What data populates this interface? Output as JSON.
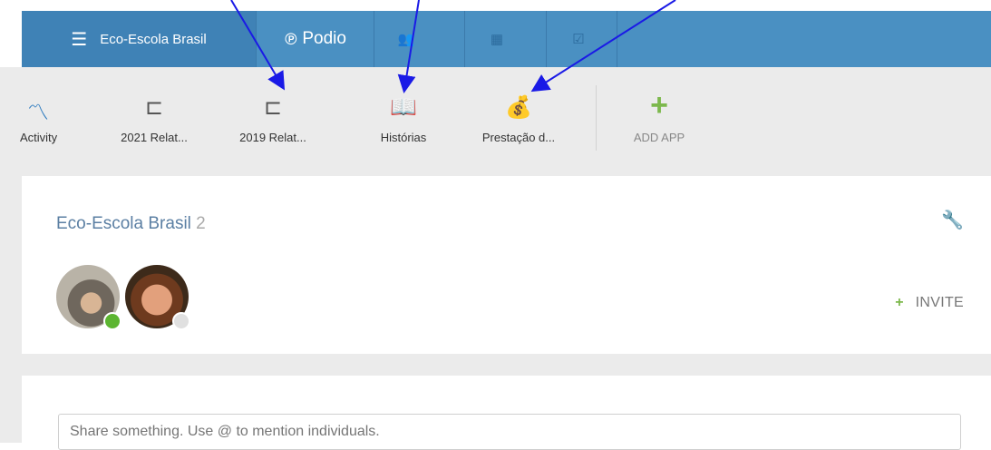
{
  "topbar": {
    "workspace_name": "Eco-Escola Brasil",
    "brand": "Podio",
    "icons": [
      "contacts-icon",
      "calendar-icon",
      "tasks-icon"
    ]
  },
  "apps": [
    {
      "label": "Activity",
      "icon": "activity-icon"
    },
    {
      "label": "2021 Relat...",
      "icon": "inbox-icon"
    },
    {
      "label": "2019 Relat...",
      "icon": "inbox-icon"
    },
    {
      "label": "Histórias",
      "icon": "book-icon"
    },
    {
      "label": "Prestação d...",
      "icon": "money-bag-icon"
    },
    {
      "label": "ADD APP",
      "icon": "plus-icon"
    }
  ],
  "workspace": {
    "title": "Eco-Escola Brasil",
    "member_count": "2",
    "invite_label": "INVITE"
  },
  "share": {
    "placeholder": "Share something. Use @ to mention individuals."
  },
  "colors": {
    "topbar": "#4a90c2",
    "accent_green": "#7cb84c",
    "annotation_arrow": "#1a1ae6"
  }
}
